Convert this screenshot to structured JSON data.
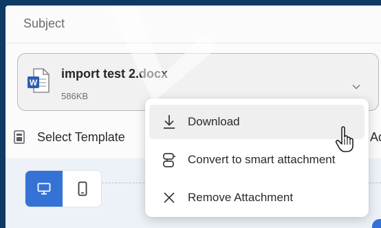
{
  "subject_label": "Subject",
  "attachment": {
    "file_name": "import test 2.docx",
    "file_size": "586KB",
    "icon": "word-doc-icon"
  },
  "template": {
    "label": "Select Template",
    "trailing_text": "Ad"
  },
  "context_menu": {
    "items": [
      {
        "label": "Download",
        "icon": "download-icon"
      },
      {
        "label": "Convert to smart attachment",
        "icon": "smart-attachment-icon"
      },
      {
        "label": "Remove Attachment",
        "icon": "close-icon"
      }
    ],
    "hovered_item": "Download"
  },
  "preview": {
    "view_modes": [
      "desktop",
      "mobile"
    ],
    "active_view": "desktop"
  },
  "colors": {
    "accent": "#3572d6",
    "frame": "#0e3a66",
    "word_blue": "#2b5fb3"
  }
}
